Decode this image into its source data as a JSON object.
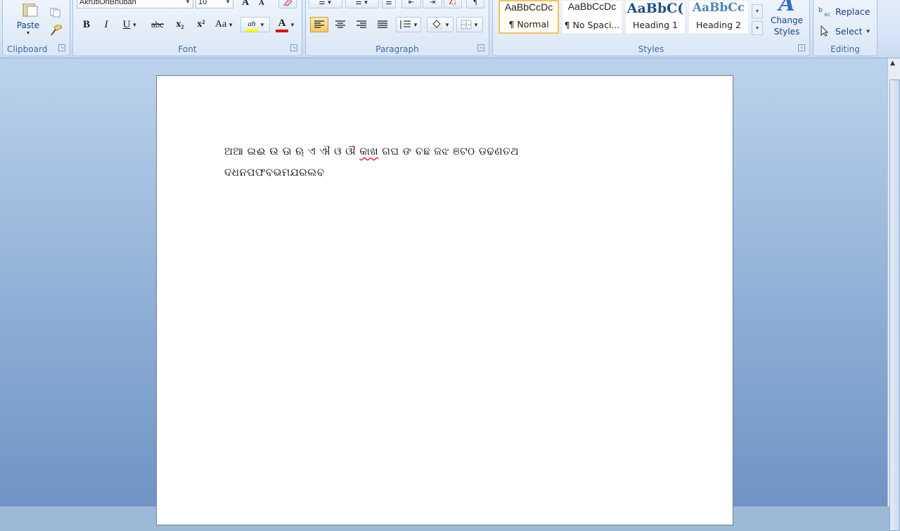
{
  "clipboard": {
    "paste_label": "Paste",
    "group_label": "Clipboard"
  },
  "font": {
    "family_value": "AkrutiOriBhuban",
    "size_value": "10",
    "group_label": "Font",
    "bold": "B",
    "italic": "I",
    "underline": "U",
    "strike": "abc",
    "subscript": "x₂",
    "superscript": "x²",
    "change_case": "Aa",
    "grow": "A",
    "shrink": "A",
    "highlight": "ab",
    "font_color": "A",
    "highlight_color": "#ffff00",
    "font_color_value": "#e00000"
  },
  "paragraph": {
    "group_label": "Paragraph"
  },
  "styles": {
    "group_label": "Styles",
    "tiles": [
      {
        "preview": "AaBbCcDc",
        "name": "¶ Normal"
      },
      {
        "preview": "AaBbCcDc",
        "name": "¶ No Spaci..."
      },
      {
        "preview": "AaBbC(",
        "name": "Heading 1"
      },
      {
        "preview": "AaBbCc",
        "name": "Heading 2"
      }
    ],
    "change_styles": "Change Styles"
  },
  "editing": {
    "group_label": "Editing",
    "replace": "Replace",
    "select": "Select"
  },
  "document": {
    "lines": [
      "ଅଆ ଇଈ ଉ ଊ ଋ ଏ ଐ ଓ ଔ",
      "କାଖ",
      "ଗଘ ଙ ଚଛ ଜଝ ଞଟଠ ଡଢଣତଥ",
      "ଦଧନପଫବଭମଯରଲବ"
    ]
  }
}
